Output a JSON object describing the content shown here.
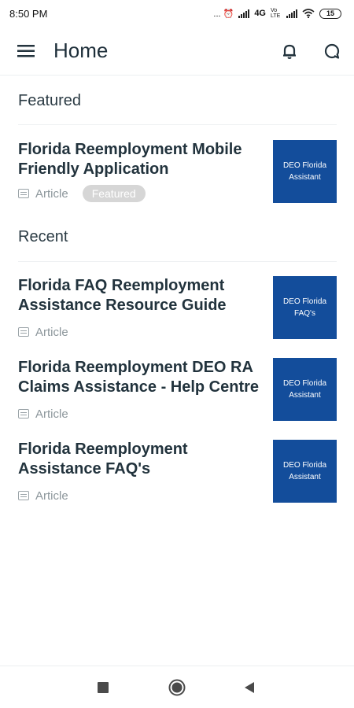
{
  "status_bar": {
    "time": "8:50 PM",
    "indicators": "... ⏰",
    "network": "4G",
    "volte": "Vo LTE",
    "battery": "15"
  },
  "app_bar": {
    "title": "Home",
    "menu_icon": "hamburger-menu-icon",
    "notification_icon": "bell-icon",
    "chat_icon": "chat-icon"
  },
  "sections": {
    "featured": "Featured",
    "recent": "Recent"
  },
  "featured_items": [
    {
      "title": "Florida Reemployment Mobile Friendly Application",
      "type": "Article",
      "badge": "Featured",
      "thumbnail": "DEO Florida Assistant"
    }
  ],
  "recent_items": [
    {
      "title": "Florida FAQ Reemployment Assistance Resource Guide",
      "type": "Article",
      "thumbnail": "DEO Florida FAQ's"
    },
    {
      "title": "Florida Reemployment DEO RA Claims Assistance - Help Centre",
      "type": "Article",
      "thumbnail": "DEO Florida Assistant"
    },
    {
      "title": "Florida Reemployment Assistance FAQ's",
      "type": "Article",
      "thumbnail": "DEO Florida Assistant"
    }
  ],
  "nav": {
    "recents_icon": "square-icon",
    "home_icon": "circle-icon",
    "back_icon": "triangle-back-icon"
  },
  "colors": {
    "thumbnail_bg": "#134d9b",
    "badge_bg": "#d6d6d6",
    "title_text": "#22333d"
  }
}
